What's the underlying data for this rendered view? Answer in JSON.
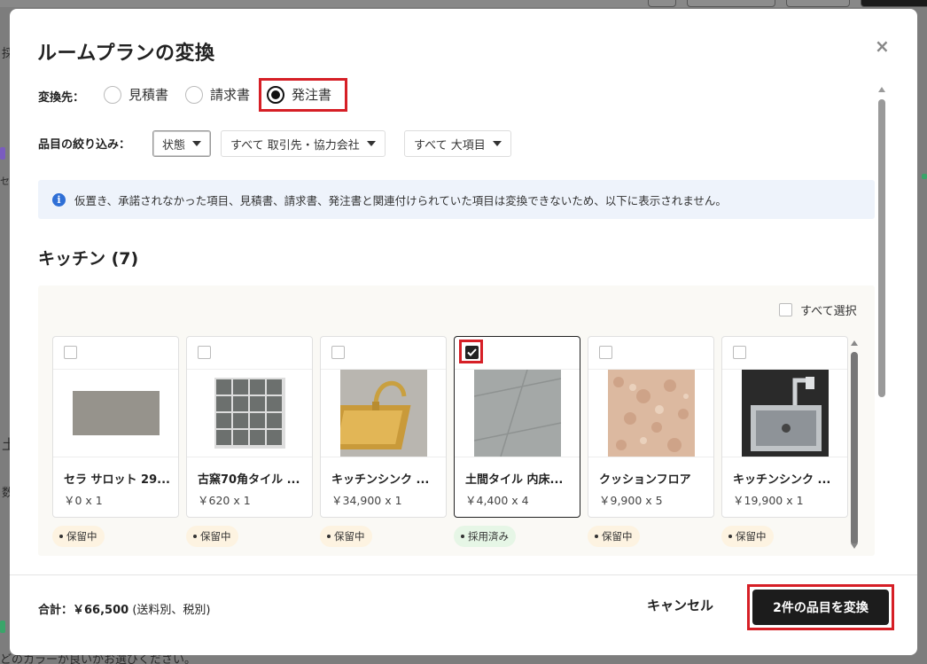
{
  "modal": {
    "title": "ルームプランの変換",
    "close_glyph": "×",
    "convert_to": {
      "label": "変換先：",
      "options": [
        {
          "label": "見積書",
          "selected": false
        },
        {
          "label": "請求書",
          "selected": false
        },
        {
          "label": "発注書",
          "selected": true
        }
      ]
    },
    "filter": {
      "label": "品目の絞り込み：",
      "dropdowns": [
        {
          "label": "状態"
        },
        {
          "label": "すべて 取引先・協力会社"
        },
        {
          "label": "すべて 大項目"
        }
      ]
    },
    "info": {
      "icon": "info-icon",
      "glyph": "i",
      "text": "仮置き、承諾されなかった項目、見積書、請求書、発注書と関連付けられていた項目は変換できないため、以下に表示されません。"
    },
    "section": {
      "title": "キッチン (7)",
      "select_all": "すべて選択",
      "items": [
        {
          "name": "セラ サロット 29...",
          "price": "￥0 x 1",
          "status": "保留中",
          "checked": false
        },
        {
          "name": "古窯70角タイル ...",
          "price": "￥620 x 1",
          "status": "保留中",
          "checked": false
        },
        {
          "name": "キッチンシンク ...",
          "price": "￥34,900 x 1",
          "status": "保留中",
          "checked": false
        },
        {
          "name": "土間タイル 内床...",
          "price": "￥4,400 x 4",
          "status": "採用済み",
          "checked": true
        },
        {
          "name": "クッションフロア",
          "price": "￥9,900 x 5",
          "status": "保留中",
          "checked": false
        },
        {
          "name": "キッチンシンク ...",
          "price": "￥19,900 x 1",
          "status": "保留中",
          "checked": false
        }
      ]
    },
    "footer": {
      "total_label": "合計：",
      "total_value": "￥66,500",
      "total_note": "(送料別、税別)",
      "cancel": "キャンセル",
      "convert": "2件の品目を変換"
    }
  },
  "background": {
    "fragments": [
      "採",
      "セ",
      "土",
      "数",
      "どのカラーが良いかお選びください。"
    ]
  },
  "colors": {
    "highlight_red": "#d61f26",
    "primary_dark": "#1c1c1c",
    "info_bg": "#eef3fb",
    "info_icon": "#2f6fd6",
    "pending_badge": "#fdf3e1",
    "adopted_badge": "#e6f6e6"
  }
}
